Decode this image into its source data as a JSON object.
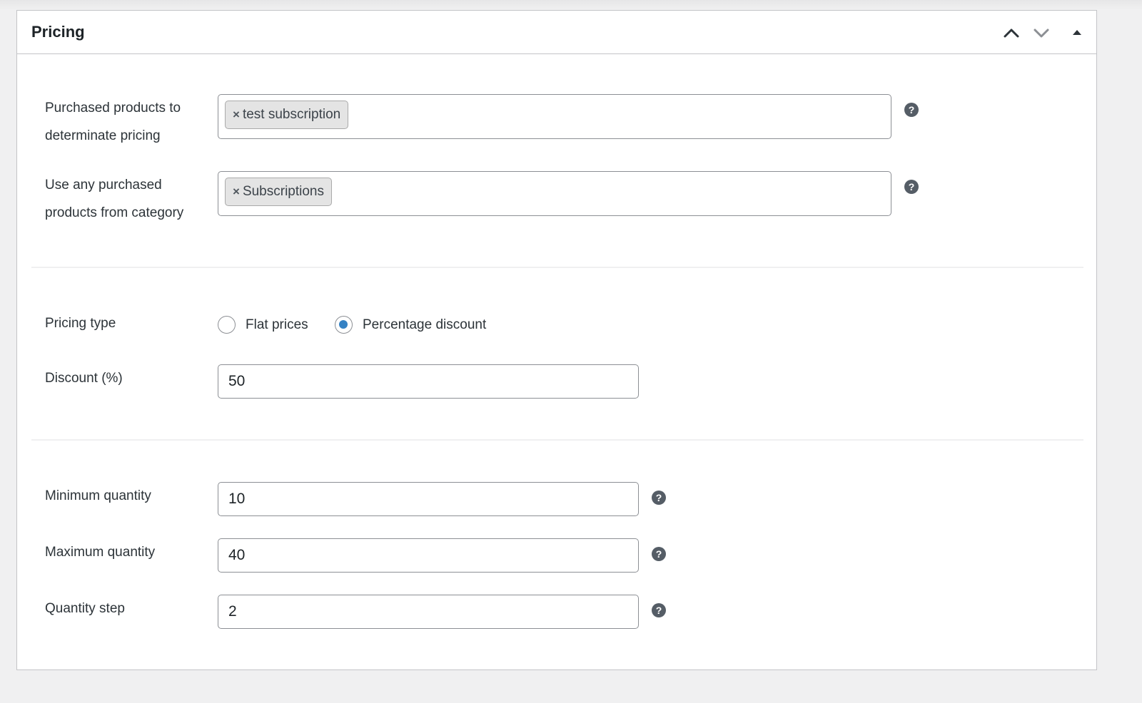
{
  "panel": {
    "title": "Pricing",
    "controls": [
      "chevron-up-icon",
      "chevron-down-icon",
      "triangle-up-icon"
    ]
  },
  "products": {
    "label_line1": "Purchased products to",
    "label_line2": "determinate pricing",
    "tags": [
      "test subscription"
    ]
  },
  "category": {
    "label_line1": "Use any purchased",
    "label_line2": "products from category",
    "tags": [
      "Subscriptions"
    ]
  },
  "pricing_type": {
    "label": "Pricing type",
    "options": [
      "Flat prices",
      "Percentage discount"
    ],
    "selected": "Percentage discount"
  },
  "discount": {
    "label": "Discount (%)",
    "value": "50"
  },
  "min_qty": {
    "label": "Minimum quantity",
    "value": "10"
  },
  "max_qty": {
    "label": "Maximum quantity",
    "value": "40"
  },
  "qty_step": {
    "label": "Quantity step",
    "value": "2"
  },
  "tag_remove_glyph": "×",
  "help_glyph": "?",
  "colors": {
    "accent": "#3582c4",
    "border": "#8c8f94",
    "help_icon": "#555d66",
    "tag_bg": "#e4e4e4"
  }
}
